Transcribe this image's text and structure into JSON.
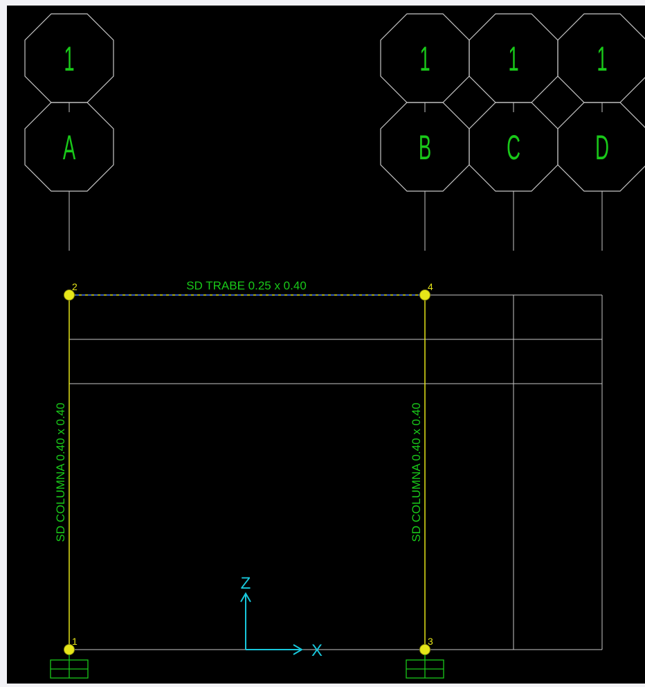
{
  "colors": {
    "background": "#000000",
    "margin": "#f2f2f6",
    "grid_line": "#c8c8c8",
    "bubble_text": "#19c819",
    "member": "#e6e619",
    "joint": "#e6e619",
    "beam_dash": "#1e50ff",
    "member_label": "#19c819",
    "joint_label": "#e6e619",
    "axis": "#19c8dc",
    "support": "#19c819"
  },
  "grid_bubbles": {
    "level_labels": [
      "1",
      "1",
      "1",
      "1"
    ],
    "column_labels": [
      "A",
      "B",
      "C",
      "D"
    ]
  },
  "beam": {
    "label": "SD TRABE 0.25 x 0.40"
  },
  "columns": [
    {
      "label": "SD COLUMNA 0.40 x 0.40"
    },
    {
      "label": "SD COLUMNA 0.40 x 0.40"
    }
  ],
  "joints": {
    "labels": [
      "1",
      "2",
      "3",
      "4"
    ]
  },
  "axes": {
    "vertical_label": "Z",
    "horizontal_label": "X"
  }
}
